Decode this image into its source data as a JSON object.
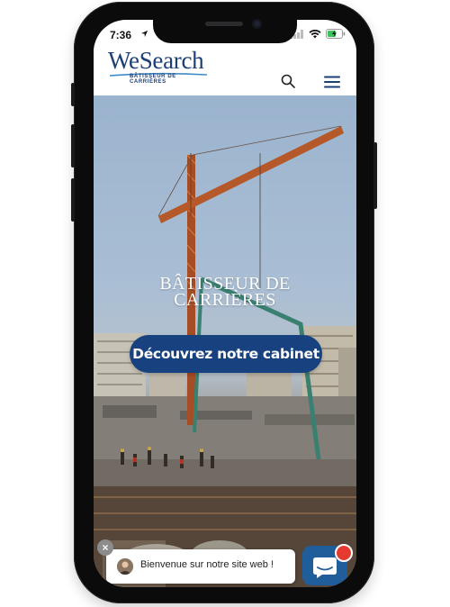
{
  "status_bar": {
    "time": "7:36",
    "icons": [
      "location-arrow-icon",
      "signal-bars-icon",
      "wifi-icon",
      "battery-charging-icon"
    ]
  },
  "header": {
    "logo_text": "WeSearch",
    "logo_tagline": "BÂTISSEUR DE CARRIÈRES",
    "search_icon": "search-icon",
    "menu_icon": "hamburger-menu-icon",
    "brand_color": "#1d3f77"
  },
  "hero": {
    "title_line1": "BÂTISSEUR DE",
    "title_line2": "CARRIÈRES",
    "cta_label": "Découvrez notre cabinet",
    "cta_color": "#17417f"
  },
  "chat": {
    "greeting": "Bienvenue sur notre site web !",
    "close_symbol": "×",
    "launcher_color": "#1f5d9b",
    "notification_color": "#e53a2f"
  }
}
